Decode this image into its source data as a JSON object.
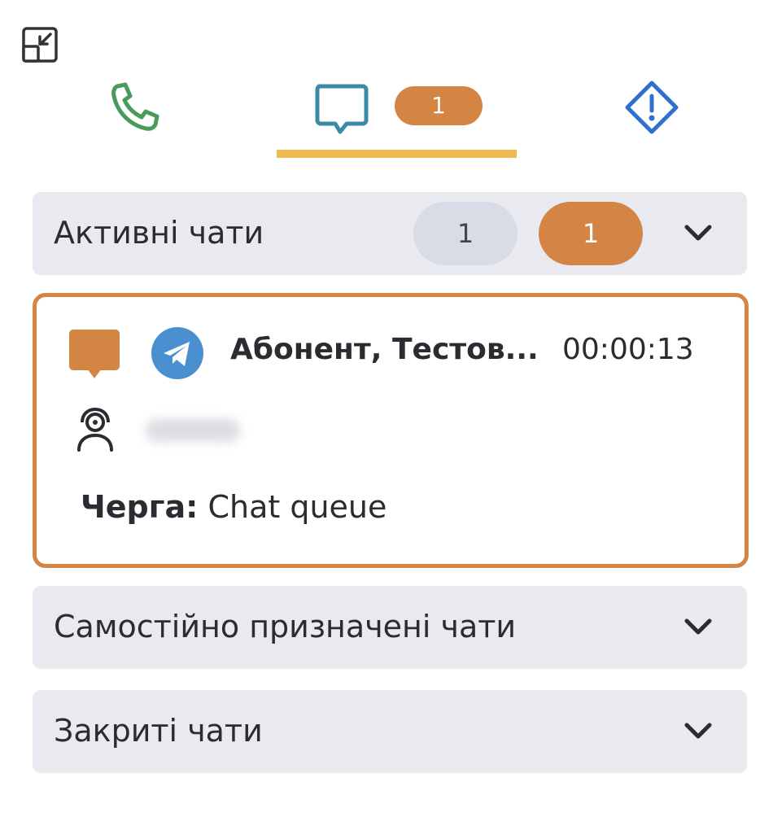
{
  "toolbar": {
    "minimize_icon": "minimize-icon"
  },
  "tabs": {
    "phone": {
      "icon": "phone-icon",
      "color": "#4a9a5b"
    },
    "chat": {
      "icon": "chat-icon",
      "badge": "1",
      "color": "#3b8aa6",
      "active": true,
      "underline_color": "#ebbb4f"
    },
    "alert": {
      "icon": "alert-diamond-icon",
      "color": "#2f6fd0"
    }
  },
  "sections": {
    "active": {
      "title": "Активні чати",
      "count_total": "1",
      "count_pending": "1",
      "expanded": true
    },
    "self_assigned": {
      "title": "Самостійно призначені чати",
      "expanded": false
    },
    "closed": {
      "title": "Закриті чати",
      "expanded": false
    }
  },
  "chat_card": {
    "channel_icon": "telegram-icon",
    "type_icon": "chat-bubble-icon",
    "subscriber": "Абонент, Тестов...",
    "timer": "00:00:13",
    "agent_icon": "agent-headset-icon",
    "queue_label": "Черга:",
    "queue_value": "Chat queue"
  },
  "colors": {
    "accent_orange": "#d48443",
    "section_bg": "#e9e9f0",
    "tab_underline": "#ebbb4f"
  }
}
